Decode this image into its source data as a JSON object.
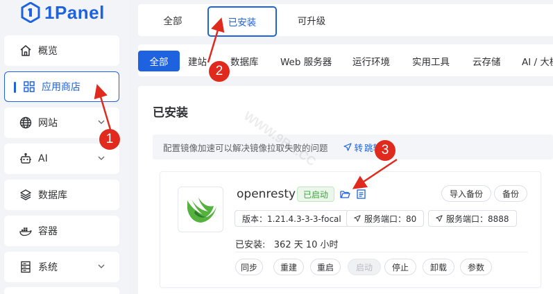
{
  "app": {
    "title": "1Panel"
  },
  "colors": {
    "accent": "#1f62e0",
    "annotation": "#e02a1e",
    "status_green": "#3fa63c"
  },
  "sidebar": {
    "items": [
      {
        "label": "概览",
        "icon": "home-icon"
      },
      {
        "label": "应用商店",
        "icon": "grid-icon",
        "active": true
      },
      {
        "label": "网站",
        "icon": "globe-icon",
        "has_submenu": true
      },
      {
        "label": "AI",
        "icon": "robot-icon",
        "has_submenu": true
      },
      {
        "label": "数据库",
        "icon": "layers-icon"
      },
      {
        "label": "容器",
        "icon": "docker-icon"
      },
      {
        "label": "系统",
        "icon": "server-icon",
        "has_submenu": true
      }
    ]
  },
  "top_tabs": [
    {
      "label": "全部"
    },
    {
      "label": "已安装",
      "active": true
    },
    {
      "label": "可升级"
    }
  ],
  "categories": [
    {
      "label": "全部",
      "active": true
    },
    {
      "label": "建站"
    },
    {
      "label": "数据库"
    },
    {
      "label": "Web 服务器"
    },
    {
      "label": "运行环境"
    },
    {
      "label": "实用工具"
    },
    {
      "label": "云存储"
    },
    {
      "label": "AI / 大模"
    }
  ],
  "panel": {
    "title": "已安装",
    "notice_text": "配置镜像加速可以解决镜像拉取失败的问题",
    "notice_link": "跳转"
  },
  "app_card": {
    "name": "openresty",
    "status": "已启动",
    "import_backup": "导入备份",
    "backup": "备份",
    "version": "版本：1.21.4.3-3-3-focal",
    "port1": "服务端口：80",
    "port2": "服务端口：8888",
    "installed": "已安装:   362 天 10 小时",
    "actions": [
      "同步",
      "重建",
      "重启",
      "启动",
      "停止",
      "卸载",
      "参数"
    ]
  },
  "watermark": "WWW.9BA.CC",
  "annotations": [
    "1",
    "2",
    "3"
  ]
}
